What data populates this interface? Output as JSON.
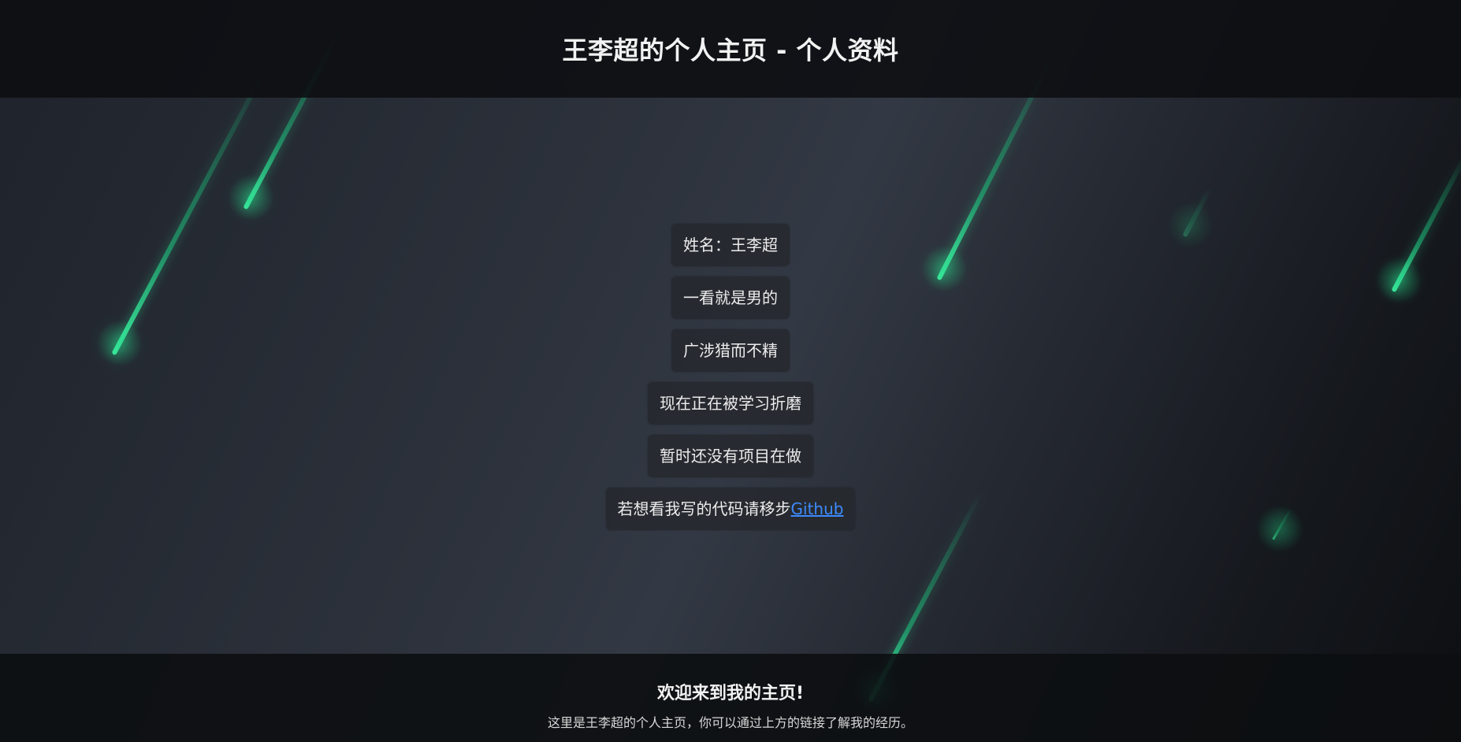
{
  "header": {
    "title": "王李超的个人主页 - 个人资料"
  },
  "profile": {
    "items": [
      {
        "text": "姓名：王李超"
      },
      {
        "text": "一看就是男的"
      },
      {
        "text": "广涉猎而不精"
      },
      {
        "text": "现在正在被学习折磨"
      },
      {
        "text": "暂时还没有项目在做"
      },
      {
        "text": "若想看我写的代码请移步",
        "link_label": "Github"
      }
    ]
  },
  "footer": {
    "heading": "欢迎来到我的主页!",
    "description": "这里是王李超的个人主页，你可以通过上方的链接了解我的经历。"
  },
  "colors": {
    "accent": "#3d8bff",
    "meteor": "#2ee89a"
  }
}
